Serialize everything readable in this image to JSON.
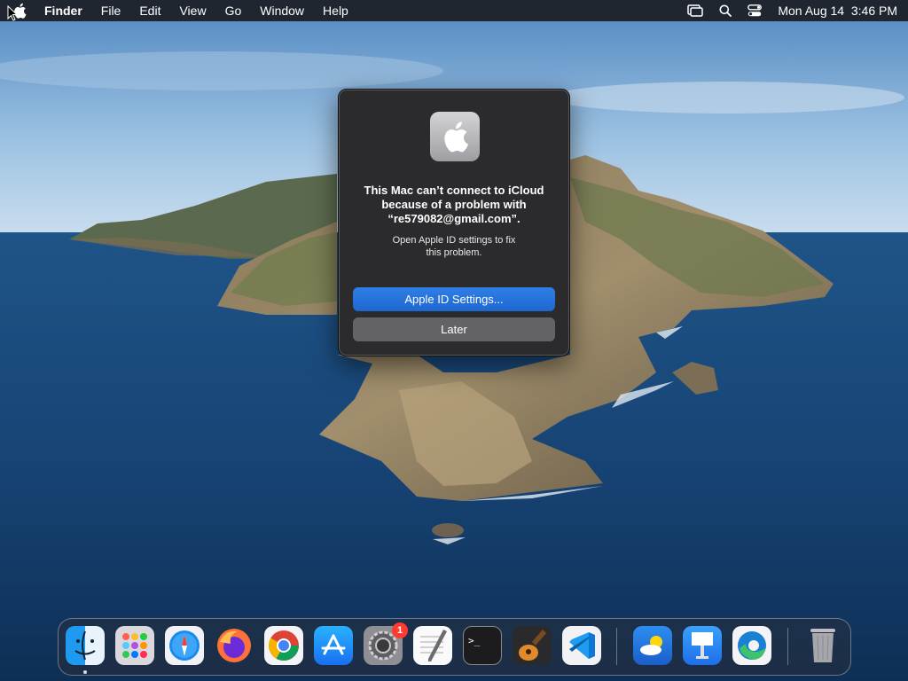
{
  "menubar": {
    "app_name": "Finder",
    "items": [
      "File",
      "Edit",
      "View",
      "Go",
      "Window",
      "Help"
    ],
    "datetime": "Mon Aug 14  3:46 PM"
  },
  "dialog": {
    "title_lines": [
      "This Mac can’t connect to iCloud",
      "because of a problem with",
      "“re579082@gmail.com”."
    ],
    "message_lines": [
      "Open Apple ID settings to fix",
      "this problem."
    ],
    "primary_button": "Apple ID Settings...",
    "secondary_button": "Later",
    "icon": "apple-logo-icon"
  },
  "dock": {
    "apps": [
      {
        "name": "finder-icon"
      },
      {
        "name": "launchpad-icon"
      },
      {
        "name": "safari-icon"
      },
      {
        "name": "firefox-icon"
      },
      {
        "name": "chrome-icon"
      },
      {
        "name": "app-store-icon"
      },
      {
        "name": "system-settings-icon",
        "badge": "1"
      },
      {
        "name": "textedit-icon"
      },
      {
        "name": "terminal-icon"
      },
      {
        "name": "garageband-icon"
      },
      {
        "name": "vscode-icon"
      },
      {
        "name": "weather-icon"
      },
      {
        "name": "keynote-icon"
      },
      {
        "name": "edge-icon"
      },
      {
        "name": "trash-icon"
      }
    ]
  },
  "colors": {
    "primary_button": "#1d67d0",
    "dialog_bg": "#2b2b2d",
    "menubar_bg": "#1f2630",
    "badge": "#ff3b30"
  }
}
